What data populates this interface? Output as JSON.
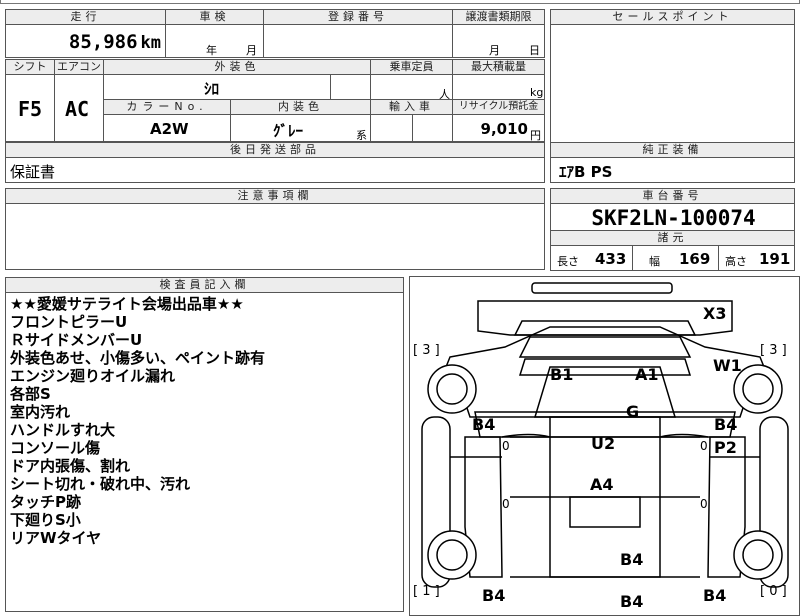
{
  "top": {
    "mileage_header": "走行",
    "mileage_value": "85,986",
    "mileage_unit": "km",
    "inspection_header": "車検",
    "inspection_year_unit": "年",
    "inspection_month_unit": "月",
    "registration_header": "登録番号",
    "transfer_header": "譲渡書類期限",
    "transfer_month_unit": "月",
    "transfer_day_unit": "日",
    "sales_header": "セールスポイント"
  },
  "spec": {
    "shift_header": "シフト",
    "shift_value": "F5",
    "ac_header": "エアコン",
    "ac_value": "AC",
    "exterior_color_header": "外装色",
    "exterior_color_value": "ｼﾛ",
    "color_no_header": "カラーNo.",
    "color_no_value": "A2W",
    "interior_color_header": "内装色",
    "interior_color_value": "ｸﾞﾚｰ",
    "interior_color_suffix": "系",
    "capacity_header": "乗車定員",
    "capacity_unit": "人",
    "max_load_header": "最大積載量",
    "max_load_unit": "kg",
    "import_header": "輸入車",
    "recycle_header": "リサイクル預託金",
    "recycle_value": "9,010",
    "recycle_unit": "円"
  },
  "parts": {
    "header": "後日発送部品",
    "value": "保証書"
  },
  "equipment": {
    "header": "純正装備",
    "value": "ｴｱB PS"
  },
  "caution": {
    "header": "注意事項欄"
  },
  "chassis": {
    "header": "車台番号",
    "value": "SKF2LN-100074"
  },
  "dimensions": {
    "header": "諸元",
    "length_label": "長さ",
    "length_value": "433",
    "width_label": "幅",
    "width_value": "169",
    "height_label": "高さ",
    "height_value": "191"
  },
  "inspector": {
    "header": "検査員記入欄",
    "notes": [
      "★★愛媛サテライト会場出品車★★",
      "フロントピラーU",
      "ＲサイドメンバーU",
      "外装色あせ、小傷多い、ペイント跡有",
      "エンジン廻りオイル漏れ",
      "各部S",
      "室内汚れ",
      "ハンドルすれ大",
      "コンソール傷",
      "ドア内張傷、割れ",
      "シート切れ・破れ中、汚れ",
      "タッチP跡",
      "下廻りS小",
      "リアWタイヤ"
    ]
  },
  "diagram": {
    "tire_fl": "[ 3 ]",
    "tire_fr": "[ 3 ]",
    "tire_rl": "[ 1 ]",
    "tire_rr": "[ 0 ]",
    "marks": [
      "X3",
      "W1",
      "B1",
      "A1",
      "G",
      "B4",
      "B4",
      "P2",
      "U2",
      "A4",
      "B4",
      "B4",
      "B4",
      "B4"
    ],
    "zeros": [
      "0",
      "0",
      "0",
      "0"
    ]
  }
}
